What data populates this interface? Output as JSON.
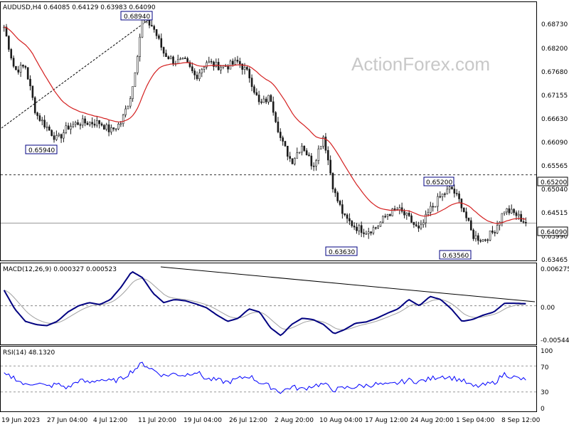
{
  "watermark": "ActionForex.com",
  "main_panel": {
    "header": "AUDUSD,H4  0.64085 0.64129 0.63983 0.64090",
    "price_axis_labels": [
      "0.68730",
      "0.68200",
      "0.67680",
      "0.67155",
      "0.66630",
      "0.66090",
      "0.65565",
      "0.65200",
      "0.65040",
      "0.64515",
      "0.63990",
      "0.63465"
    ],
    "current_price_label": "0.64090",
    "resistance_label": "0.65200",
    "annotations": [
      "0.68940",
      "0.65940",
      "0.63630",
      "0.65200",
      "0.63560"
    ]
  },
  "macd_panel": {
    "header": "MACD(12,26,9) 0.000327 0.000523",
    "axis_labels": [
      "0.006275",
      "0.00",
      "-0.005446"
    ]
  },
  "rsi_panel": {
    "header": "RSI(14) 48.1320",
    "axis_labels": [
      "100",
      "70",
      "30",
      "0"
    ]
  },
  "date_labels": [
    "19 Jun 2023",
    "27 Jun 04:00",
    "4 Jul 12:00",
    "11 Jul 20:00",
    "19 Jul 04:00",
    "26 Jul 12:00",
    "2 Aug 20:00",
    "10 Aug 04:00",
    "17 Aug 12:00",
    "24 Aug 20:00",
    "1 Sep 04:00",
    "8 Sep 12:00"
  ],
  "chart_data": {
    "type": "line",
    "series": [
      {
        "name": "AUDUSD,H4",
        "values": [
          0.686,
          0.676,
          0.677,
          0.666,
          0.663,
          0.66,
          0.663,
          0.664,
          0.664,
          0.664,
          0.662,
          0.664,
          0.671,
          0.688,
          0.686,
          0.68,
          0.678,
          0.678,
          0.6745,
          0.678,
          0.677,
          0.677,
          0.678,
          0.675,
          0.668,
          0.67,
          0.66,
          0.655,
          0.659,
          0.654,
          0.661,
          0.648,
          0.642,
          0.64,
          0.639,
          0.64,
          0.643,
          0.644,
          0.642,
          0.639,
          0.644,
          0.647,
          0.649,
          0.645,
          0.638,
          0.637,
          0.639,
          0.644,
          0.643,
          0.6409
        ]
      },
      {
        "name": "MACD",
        "values": [
          0.0025,
          -0.0005,
          -0.0025,
          -0.003,
          -0.0032,
          -0.0025,
          -0.001,
          0.0,
          0.0005,
          0.0002,
          0.001,
          0.003,
          0.0055,
          0.0045,
          0.002,
          0.0005,
          0.001,
          0.0008,
          0.0003,
          -0.0003,
          -0.0015,
          -0.0025,
          -0.002,
          -0.0005,
          -0.001,
          -0.0035,
          -0.0048,
          -0.003,
          -0.002,
          -0.0022,
          -0.003,
          -0.0045,
          -0.0038,
          -0.0028,
          -0.0026,
          -0.002,
          -0.0012,
          -0.0005,
          0.001,
          0.0,
          0.0015,
          0.001,
          -0.0005,
          -0.0025,
          -0.0022,
          -0.0015,
          -0.001,
          0.0004,
          0.0004,
          0.000327
        ]
      },
      {
        "name": "RSI(14)",
        "values": [
          56,
          52,
          40,
          45,
          38,
          42,
          36,
          48,
          44,
          50,
          46,
          50,
          62,
          74,
          64,
          55,
          58,
          56,
          62,
          50,
          48,
          45,
          50,
          55,
          45,
          38,
          30,
          38,
          34,
          40,
          42,
          33,
          36,
          38,
          40,
          42,
          40,
          44,
          48,
          46,
          50,
          55,
          52,
          48,
          38,
          40,
          44,
          58,
          52,
          48.13
        ]
      }
    ],
    "x_tick_labels": [
      "19 Jun 2023",
      "27 Jun 04:00",
      "4 Jul 12:00",
      "11 Jul 20:00",
      "19 Jul 04:00",
      "26 Jul 12:00",
      "2 Aug 20:00",
      "10 Aug 04:00",
      "17 Aug 12:00",
      "24 Aug 20:00",
      "1 Sep 04:00",
      "8 Sep 12:00"
    ],
    "price_ylim": [
      0.6323,
      0.6917
    ],
    "macd_ylim": [
      -0.0062,
      0.0068
    ],
    "rsi_ylim": [
      0,
      100
    ],
    "price_levels": [
      0.652,
      0.6409
    ],
    "rsi_levels": [
      70,
      30
    ],
    "trendlines": [
      "rising dashed line into 0.68940 high",
      "falling MACD trendline from 11 Jul 20:00 to 8 Sep 12:00"
    ],
    "colors": {
      "price": "#1a1a1a",
      "moving_average": "#d42020",
      "macd": "#000080",
      "macd_signal": "#a0a0a0",
      "rsi": "#0000ff",
      "label_box_border": "#000080"
    }
  }
}
